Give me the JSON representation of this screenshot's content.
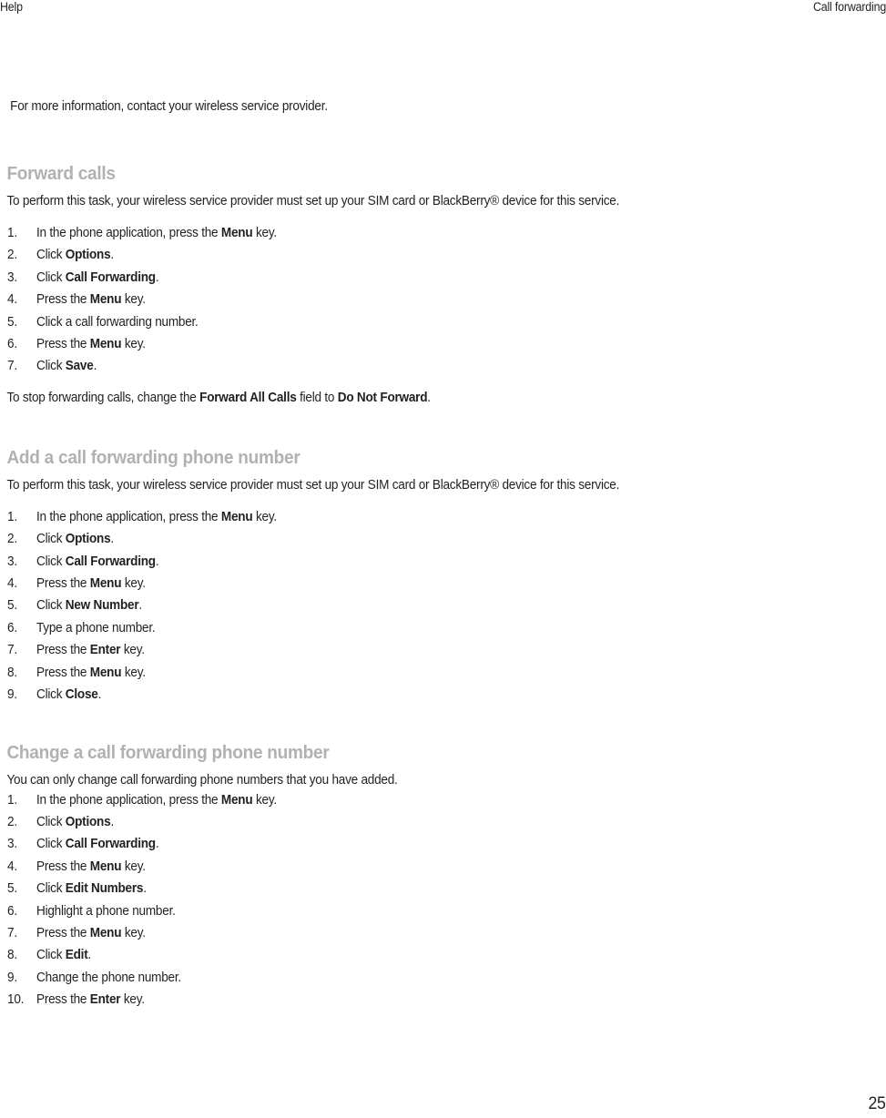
{
  "header": {
    "left": "Help",
    "right": "Call forwarding"
  },
  "intro_paragraph": "For more information, contact your wireless service provider.",
  "sections": [
    {
      "heading": "Forward calls",
      "intro": "To perform this task, your wireless service provider must set up your SIM card or BlackBerry® device for this service.",
      "steps": [
        {
          "num": "1.",
          "pre": "In the phone application, press the ",
          "bold": "Menu",
          "post": " key."
        },
        {
          "num": "2.",
          "pre": "Click ",
          "bold": "Options",
          "post": "."
        },
        {
          "num": "3.",
          "pre": "Click ",
          "bold": "Call Forwarding",
          "post": "."
        },
        {
          "num": "4.",
          "pre": "Press the ",
          "bold": "Menu",
          "post": " key."
        },
        {
          "num": "5.",
          "pre": "Click a call forwarding number.",
          "bold": "",
          "post": ""
        },
        {
          "num": "6.",
          "pre": "Press the ",
          "bold": "Menu",
          "post": " key."
        },
        {
          "num": "7.",
          "pre": "Click ",
          "bold": "Save",
          "post": "."
        }
      ],
      "outro_parts": [
        {
          "text": "To stop forwarding calls, change the ",
          "bold": false
        },
        {
          "text": "Forward All Calls",
          "bold": true
        },
        {
          "text": " field to ",
          "bold": false
        },
        {
          "text": "Do Not Forward",
          "bold": true
        },
        {
          "text": ".",
          "bold": false
        }
      ]
    },
    {
      "heading": "Add a call forwarding phone number",
      "intro": "To perform this task, your wireless service provider must set up your SIM card or BlackBerry® device for this service.",
      "steps": [
        {
          "num": "1.",
          "pre": "In the phone application, press the ",
          "bold": "Menu",
          "post": " key."
        },
        {
          "num": "2.",
          "pre": "Click ",
          "bold": "Options",
          "post": "."
        },
        {
          "num": "3.",
          "pre": "Click ",
          "bold": "Call Forwarding",
          "post": "."
        },
        {
          "num": "4.",
          "pre": "Press the ",
          "bold": "Menu",
          "post": " key."
        },
        {
          "num": "5.",
          "pre": "Click ",
          "bold": "New Number",
          "post": "."
        },
        {
          "num": "6.",
          "pre": "Type a phone number.",
          "bold": "",
          "post": ""
        },
        {
          "num": "7.",
          "pre": "Press the ",
          "bold": "Enter",
          "post": " key."
        },
        {
          "num": "8.",
          "pre": "Press the ",
          "bold": "Menu",
          "post": " key."
        },
        {
          "num": "9.",
          "pre": "Click ",
          "bold": "Close",
          "post": "."
        }
      ]
    },
    {
      "heading": "Change a call forwarding phone number",
      "intro": "You can only change call forwarding phone numbers that you have added.",
      "steps": [
        {
          "num": "1.",
          "pre": "In the phone application, press the ",
          "bold": "Menu",
          "post": " key."
        },
        {
          "num": "2.",
          "pre": "Click ",
          "bold": "Options",
          "post": "."
        },
        {
          "num": "3.",
          "pre": "Click ",
          "bold": "Call Forwarding",
          "post": "."
        },
        {
          "num": "4.",
          "pre": "Press the ",
          "bold": "Menu",
          "post": " key."
        },
        {
          "num": "5.",
          "pre": "Click ",
          "bold": "Edit Numbers",
          "post": "."
        },
        {
          "num": "6.",
          "pre": "Highlight a phone number.",
          "bold": "",
          "post": ""
        },
        {
          "num": "7.",
          "pre": "Press the ",
          "bold": "Menu",
          "post": " key."
        },
        {
          "num": "8.",
          "pre": "Click ",
          "bold": "Edit",
          "post": "."
        },
        {
          "num": "9.",
          "pre": "Change the phone number.",
          "bold": "",
          "post": ""
        },
        {
          "num": "10.",
          "pre": "Press the ",
          "bold": "Enter",
          "post": " key."
        }
      ]
    }
  ],
  "footer": {
    "page_number": "25"
  },
  "colors": {
    "heading": "#b1b1b1",
    "body_text": "#231f20",
    "background": "#ffffff"
  }
}
